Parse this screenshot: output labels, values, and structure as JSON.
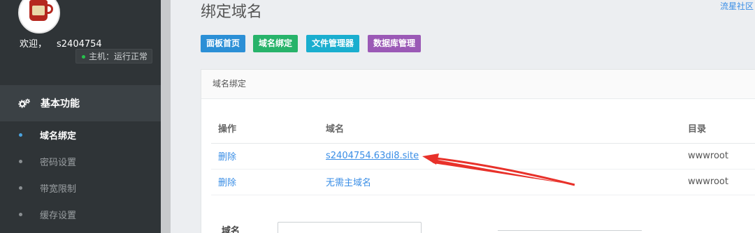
{
  "sidebar": {
    "welcome": "欢迎，",
    "username": "s2404754",
    "host_status": "主机：运行正常",
    "section_title": "基本功能",
    "items": [
      {
        "label": "域名绑定",
        "active": true
      },
      {
        "label": "密码设置",
        "active": false
      },
      {
        "label": "带宽限制",
        "active": false
      },
      {
        "label": "缓存设置",
        "active": false
      }
    ]
  },
  "header": {
    "title": "绑定域名",
    "community_link": "流星社区"
  },
  "toolbar": {
    "buttons": [
      {
        "label": "面板首页",
        "color": "#2b8fd6"
      },
      {
        "label": "域名绑定",
        "color": "#27b36a"
      },
      {
        "label": "文件管理器",
        "color": "#1aaecf"
      },
      {
        "label": "数据库管理",
        "color": "#9b59b6"
      }
    ]
  },
  "panel": {
    "title": "域名绑定",
    "columns": [
      "操作",
      "域名",
      "目录"
    ],
    "rows": [
      {
        "action": "删除",
        "domain": "s2404754.63di8.site",
        "dir": "wwwroot"
      },
      {
        "action": "删除",
        "domain": "无需主域名",
        "dir": "wwwroot"
      }
    ]
  },
  "form": {
    "domain_label": "域名"
  },
  "colors": {
    "sidebar_bg": "#2f3437",
    "accent_blue": "#3a8ee6",
    "arrow_red": "#e8312a"
  }
}
